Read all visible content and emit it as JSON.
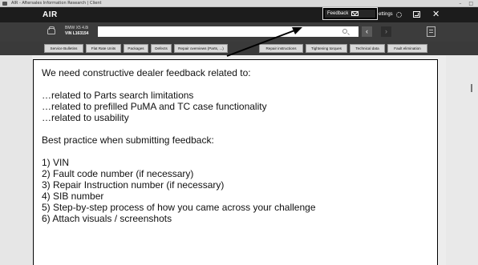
{
  "window": {
    "title": "AIR - Aftersales Information Research | Client"
  },
  "header": {
    "app_name": "AIR",
    "feedback_label": "Feedback",
    "settings_label": "ettings",
    "restore_glyph": "",
    "close_glyph": "✕"
  },
  "vehicle": {
    "model": "BMW X5 4.8i",
    "vin": "VIN L163154"
  },
  "search": {
    "value": "",
    "back_glyph": "‹",
    "forward_glyph": "›"
  },
  "tabs": [
    {
      "label": "Service Bulletins"
    },
    {
      "label": "Flat Rate Units"
    },
    {
      "label": "Packages"
    },
    {
      "label": "Defects"
    },
    {
      "label": "Repair overviews (Parts, ...)"
    },
    {
      "label": "Repair instructions"
    },
    {
      "label": "Tightening torques"
    },
    {
      "label": "Technical data"
    },
    {
      "label": "Fault elimination"
    }
  ],
  "callout": {
    "intro": "We need constructive dealer feedback related to:",
    "related_items": [
      "…related to Parts search limitations",
      "…related to prefilled PuMA and TC case functionality",
      "…related to usability"
    ],
    "best_practice_heading": "Best practice when submitting feedback:",
    "steps": [
      "1)  VIN",
      "2)  Fault code number (if necessary)",
      "3)  Repair Instruction number (if necessary)",
      "4)  SIB number",
      "5)  Step-by-step process of how you came across your challenge",
      "6)  Attach visuals / screenshots"
    ]
  },
  "colors": {
    "header_bg": "#1c1c1c",
    "vehicle_bar_bg": "#3c3c3c",
    "tab_bg": "#d9d9d9",
    "callout_bg": "#ffffff",
    "arrow": "#000000"
  }
}
